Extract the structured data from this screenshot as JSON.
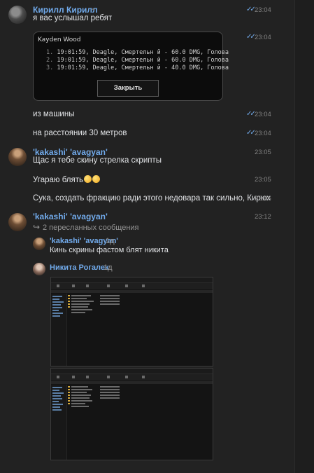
{
  "messages": [
    {
      "author": "Кирилл Кирилл",
      "text": "я вас услышал ребят",
      "time": "23:04"
    },
    {
      "time": "23:04"
    },
    {
      "text": "из машины",
      "time": "23:04"
    },
    {
      "text": "на расстоянии 30 метров",
      "time": "23:04"
    },
    {
      "author": "'kakashi' 'avagyan'",
      "text": "Щас я тебе скину стрелка скрипты",
      "time": "23:05"
    },
    {
      "text": "Угараю блять",
      "time": "23:05"
    },
    {
      "text": "Сука, создать фракцию ради этого недовара так сильно, Кирюх",
      "time": "23:06"
    },
    {
      "author": "'kakashi' 'avagyan'",
      "time": "23:12"
    }
  ],
  "game_dialog": {
    "title": "Kayden Wood",
    "lines": [
      {
        "num": "1.",
        "text": "19:01:59, Deagle, Смертельн й - 60.0 DMG, Голова"
      },
      {
        "num": "2.",
        "text": "19:01:59, Deagle, Смертельн й - 60.0 DMG, Голова"
      },
      {
        "num": "3.",
        "text": "19:01:59, Deagle, Смертельн й - 40.0 DMG, Голова"
      }
    ],
    "close_label": "Закрыть"
  },
  "forwarded": {
    "label": "2 пересланных сообщения",
    "items": [
      {
        "author": "'kakashi' 'avagyan'",
        "time": "1д",
        "text": "Кинь скрины фастом блят никита"
      },
      {
        "author": "Никита Рогалек",
        "time": "1д"
      }
    ]
  },
  "colors": {
    "accent": "#71aaeb",
    "background": "#222222",
    "text": "#e1e3e6",
    "muted": "#828282"
  }
}
